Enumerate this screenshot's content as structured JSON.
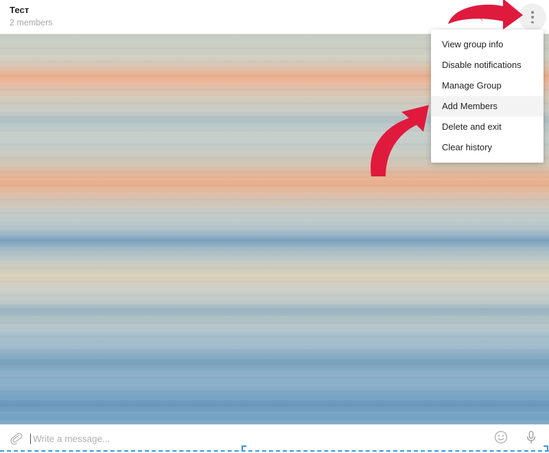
{
  "app": {
    "accent_red": "#e01a3c",
    "menu_highlight": "#f3f3f3",
    "drop_indicator_color": "#3a94d6"
  },
  "header": {
    "title": "Тест",
    "subtitle": "2 members",
    "icons": {
      "search": "search-icon",
      "pinned": "pinned-messages-icon",
      "more": "more-vertical-icon"
    }
  },
  "menu": {
    "items": [
      {
        "label": "View group info",
        "selected": false
      },
      {
        "label": "Disable notifications",
        "selected": false
      },
      {
        "label": "Manage Group",
        "selected": false
      },
      {
        "label": "Add Members",
        "selected": true
      },
      {
        "label": "Delete and exit",
        "selected": false
      },
      {
        "label": "Clear history",
        "selected": false
      }
    ]
  },
  "annotations": {
    "arrow_to_menu_button": "curved-arrow-right",
    "arrow_to_add_members": "curved-arrow-up-right",
    "color": "#e01a3c"
  },
  "composer": {
    "attach_icon": "paperclip-icon",
    "placeholder": "Write a message...",
    "value": "",
    "emoji_icon": "smiley-icon",
    "voice_icon": "microphone-icon"
  }
}
